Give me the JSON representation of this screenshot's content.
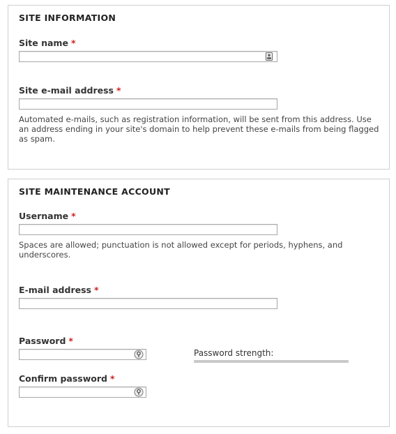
{
  "site_information": {
    "legend": "SITE INFORMATION",
    "site_name": {
      "label": "Site name",
      "required_mark": "*",
      "value": ""
    },
    "site_email": {
      "label": "Site e-mail address",
      "required_mark": "*",
      "value": "",
      "description": "Automated e-mails, such as registration information, will be sent from this address. Use an address ending in your site's domain to help prevent these e-mails from being flagged as spam."
    }
  },
  "site_maintenance_account": {
    "legend": "SITE MAINTENANCE ACCOUNT",
    "username": {
      "label": "Username",
      "required_mark": "*",
      "value": "",
      "description": "Spaces are allowed; punctuation is not allowed except for periods, hyphens, and underscores."
    },
    "email": {
      "label": "E-mail address",
      "required_mark": "*",
      "value": ""
    },
    "password": {
      "label": "Password",
      "required_mark": "*",
      "value": ""
    },
    "password_strength": {
      "label": "Password strength:",
      "level": 0
    },
    "confirm_password": {
      "label": "Confirm password",
      "required_mark": "*",
      "value": ""
    }
  }
}
